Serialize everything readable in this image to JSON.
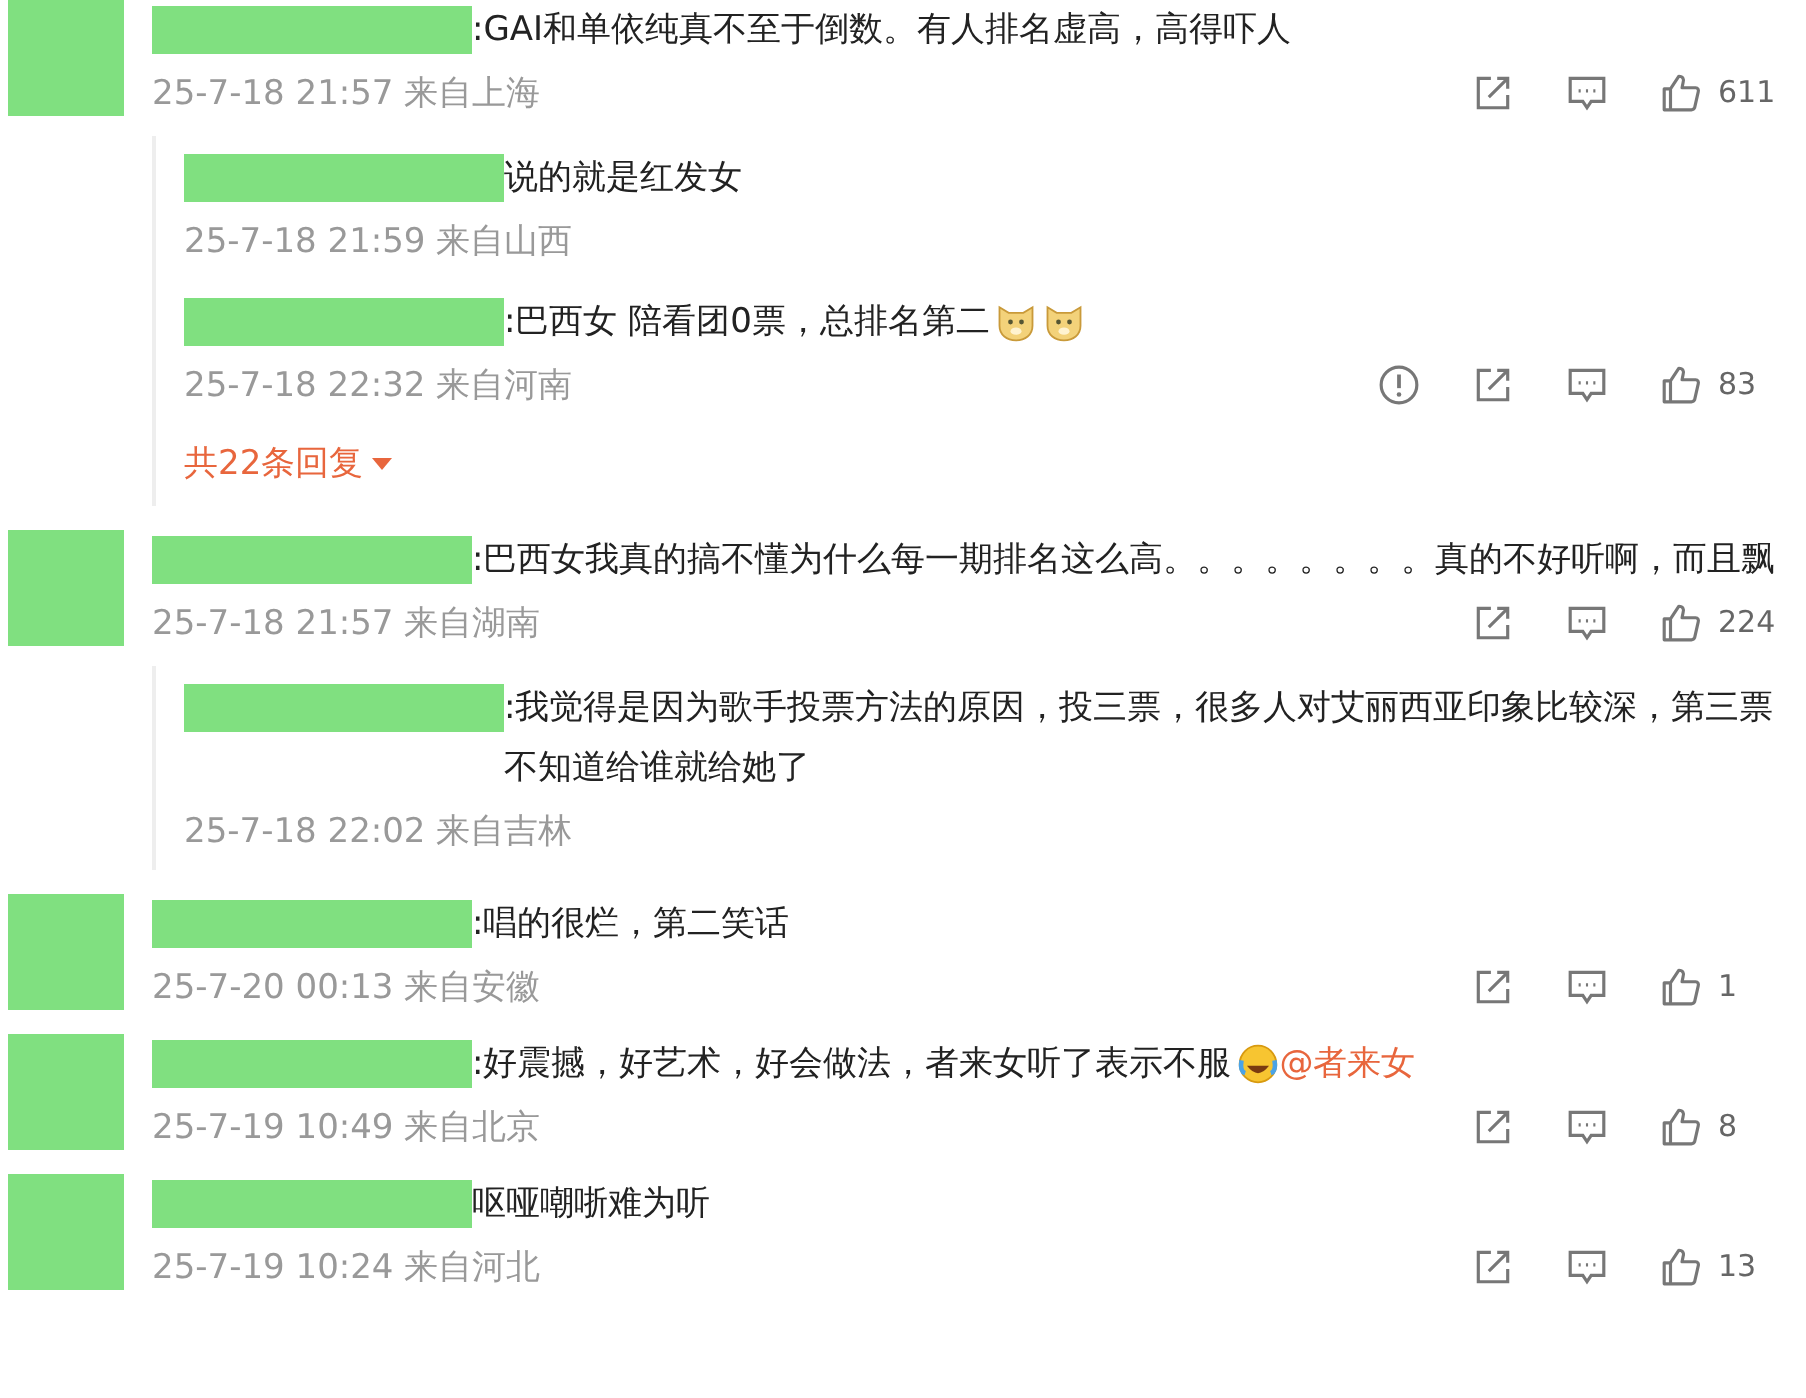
{
  "comments": [
    {
      "text": ":GAI和单依纯真不至于倒数。有人排名虚高，高得吓人",
      "time": "25-7-18 21:57",
      "location": "来自上海",
      "actions": [
        {
          "kind": "share"
        },
        {
          "kind": "comment"
        },
        {
          "kind": "like",
          "count": "611"
        }
      ],
      "replies": [
        {
          "text": "说的就是红发女",
          "time": "25-7-18 21:59",
          "location": "来自山西"
        },
        {
          "text": ":巴西女 陪看团0票，总排名第二",
          "emojis": [
            {
              "kind": "dog"
            },
            {
              "kind": "dog"
            }
          ],
          "time": "25-7-18 22:32",
          "location": "来自河南",
          "actions": [
            {
              "kind": "report"
            },
            {
              "kind": "share"
            },
            {
              "kind": "comment"
            },
            {
              "kind": "like",
              "count": "83"
            }
          ]
        }
      ],
      "more_replies": "共22条回复"
    },
    {
      "text": ":巴西女我真的搞不懂为什么每一期排名这么高。。。。。。。。真的不好听啊，而且飘",
      "time": "25-7-18 21:57",
      "location": "来自湖南",
      "actions": [
        {
          "kind": "share"
        },
        {
          "kind": "comment"
        },
        {
          "kind": "like",
          "count": "224"
        }
      ],
      "replies": [
        {
          "text": ":我觉得是因为歌手投票方法的原因，投三票，很多人对艾丽西亚印象比较深，第三票不知道给谁就给她了",
          "time": "25-7-18 22:02",
          "location": "来自吉林"
        }
      ]
    },
    {
      "text": ":唱的很烂，第二笑话",
      "time": "25-7-20 00:13",
      "location": "来自安徽",
      "actions": [
        {
          "kind": "share"
        },
        {
          "kind": "comment"
        },
        {
          "kind": "like",
          "count": "1"
        }
      ]
    },
    {
      "text": ":好震撼，好艺术，好会做法，者来女听了表示不服",
      "emojis": [
        {
          "kind": "laugh-cry"
        }
      ],
      "mention": "@者来女",
      "time": "25-7-19 10:49",
      "location": "来自北京",
      "actions": [
        {
          "kind": "share"
        },
        {
          "kind": "comment"
        },
        {
          "kind": "like",
          "count": "8"
        }
      ]
    },
    {
      "text": "呕哑嘲哳难为听",
      "time": "25-7-19 10:24",
      "location": "来自河北",
      "actions": [
        {
          "kind": "share"
        },
        {
          "kind": "comment"
        },
        {
          "kind": "like",
          "count": "13"
        }
      ]
    }
  ]
}
